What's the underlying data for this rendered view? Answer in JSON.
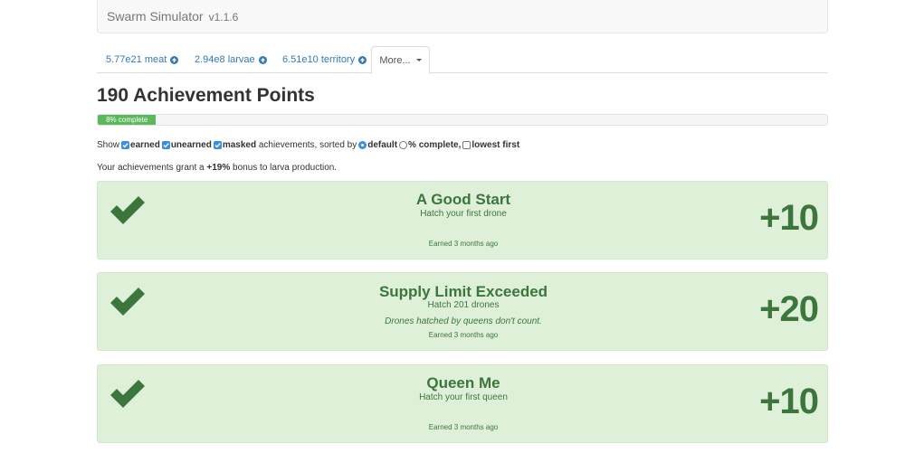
{
  "header": {
    "brand": "Swarm Simulator",
    "version": "v1.1.6"
  },
  "tabs": [
    {
      "label": "5.77e21 meat",
      "icon": "arrow-up-circle-icon"
    },
    {
      "label": "2.94e8 larvae",
      "icon": "arrow-up-circle-icon"
    },
    {
      "label": "6.51e10 territory",
      "icon": "arrow-up-circle-icon"
    },
    {
      "label": "More...",
      "icon": "caret-down-icon"
    }
  ],
  "points": {
    "value": "190",
    "label": "Achievement Points"
  },
  "progress": {
    "percent": 8,
    "label": "8% complete"
  },
  "filters": {
    "show_label": "Show",
    "earned": {
      "label": "earned",
      "checked": true
    },
    "unearned": {
      "label": "unearned",
      "checked": true
    },
    "masked": {
      "label": "masked",
      "checked": true
    },
    "suffix": "achievements, sorted by",
    "sort_default": {
      "label": "default",
      "selected": true
    },
    "sort_complete": {
      "label": "% complete,",
      "selected": false
    },
    "lowest_first": {
      "label": "lowest first",
      "checked": false
    }
  },
  "bonus": {
    "prefix": "Your achievements grant a",
    "value": "+19%",
    "suffix": "bonus to larva production."
  },
  "achievements": [
    {
      "title": "A Good Start",
      "desc": "Hatch your first drone",
      "note": "",
      "earned": "Earned 3 months ago",
      "points": "+10"
    },
    {
      "title": "Supply Limit Exceeded",
      "desc": "Hatch 201 drones",
      "note": "Drones hatched by queens don't count.",
      "earned": "Earned 3 months ago",
      "points": "+20"
    },
    {
      "title": "Queen Me",
      "desc": "Hatch your first queen",
      "note": "",
      "earned": "Earned 3 months ago",
      "points": "+10"
    }
  ],
  "colors": {
    "success_bg": "#dff0d8",
    "success_text": "#3c763d",
    "link": "#337ab7",
    "progress": "#5cb85c"
  }
}
